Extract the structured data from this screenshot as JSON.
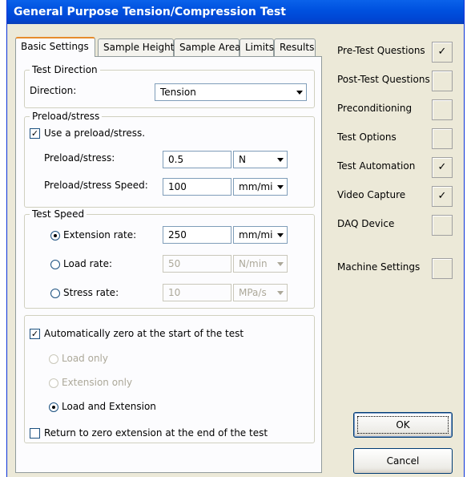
{
  "window": {
    "title": "General Purpose Tension/Compression Test"
  },
  "tabs": [
    {
      "label": "Basic Settings",
      "active": true
    },
    {
      "label": "Sample Height"
    },
    {
      "label": "Sample Area"
    },
    {
      "label": "Limits"
    },
    {
      "label": "Results"
    }
  ],
  "test_direction": {
    "legend": "Test Direction",
    "label": "Direction:",
    "value": "Tension"
  },
  "preload": {
    "legend": "Preload/stress",
    "use_label": "Use a preload/stress.",
    "use_checked": "✓",
    "preload_label": "Preload/stress:",
    "preload_value": "0.5",
    "preload_unit": "N",
    "speed_label": "Preload/stress Speed:",
    "speed_value": "100",
    "speed_unit": "mm/mi"
  },
  "test_speed": {
    "legend": "Test Speed",
    "extension_label": "Extension rate:",
    "extension_value": "250",
    "extension_unit": "mm/mi",
    "load_label": "Load rate:",
    "load_value": "50",
    "load_unit": "N/min",
    "stress_label": "Stress rate:",
    "stress_value": "10",
    "stress_unit": "MPa/s",
    "selected": "Extension rate"
  },
  "zero": {
    "auto_label": "Automatically zero at the start of the test",
    "auto_checked": "✓",
    "load_only": "Load only",
    "extension_only": "Extension only",
    "load_and_extension": "Load and Extension",
    "return_label": "Return to zero extension at the end of the test",
    "return_checked": ""
  },
  "side_options": [
    {
      "label": "Pre-Test Questions",
      "checked": "✓"
    },
    {
      "label": "Post-Test Questions",
      "checked": ""
    },
    {
      "label": "Preconditioning",
      "checked": ""
    },
    {
      "label": "Test Options",
      "checked": ""
    },
    {
      "label": "Test Automation",
      "checked": "✓"
    },
    {
      "label": "Video Capture",
      "checked": "✓"
    },
    {
      "label": "DAQ Device",
      "checked": ""
    },
    {
      "label": "Machine Settings",
      "checked": ""
    }
  ],
  "buttons": {
    "ok": "OK",
    "cancel": "Cancel"
  },
  "colors": {
    "titlebar": "#0052e0",
    "window_bg": "#ece9d8",
    "panel_bg": "#fcfcfe",
    "active_tab_accent": "#e68b2c"
  }
}
